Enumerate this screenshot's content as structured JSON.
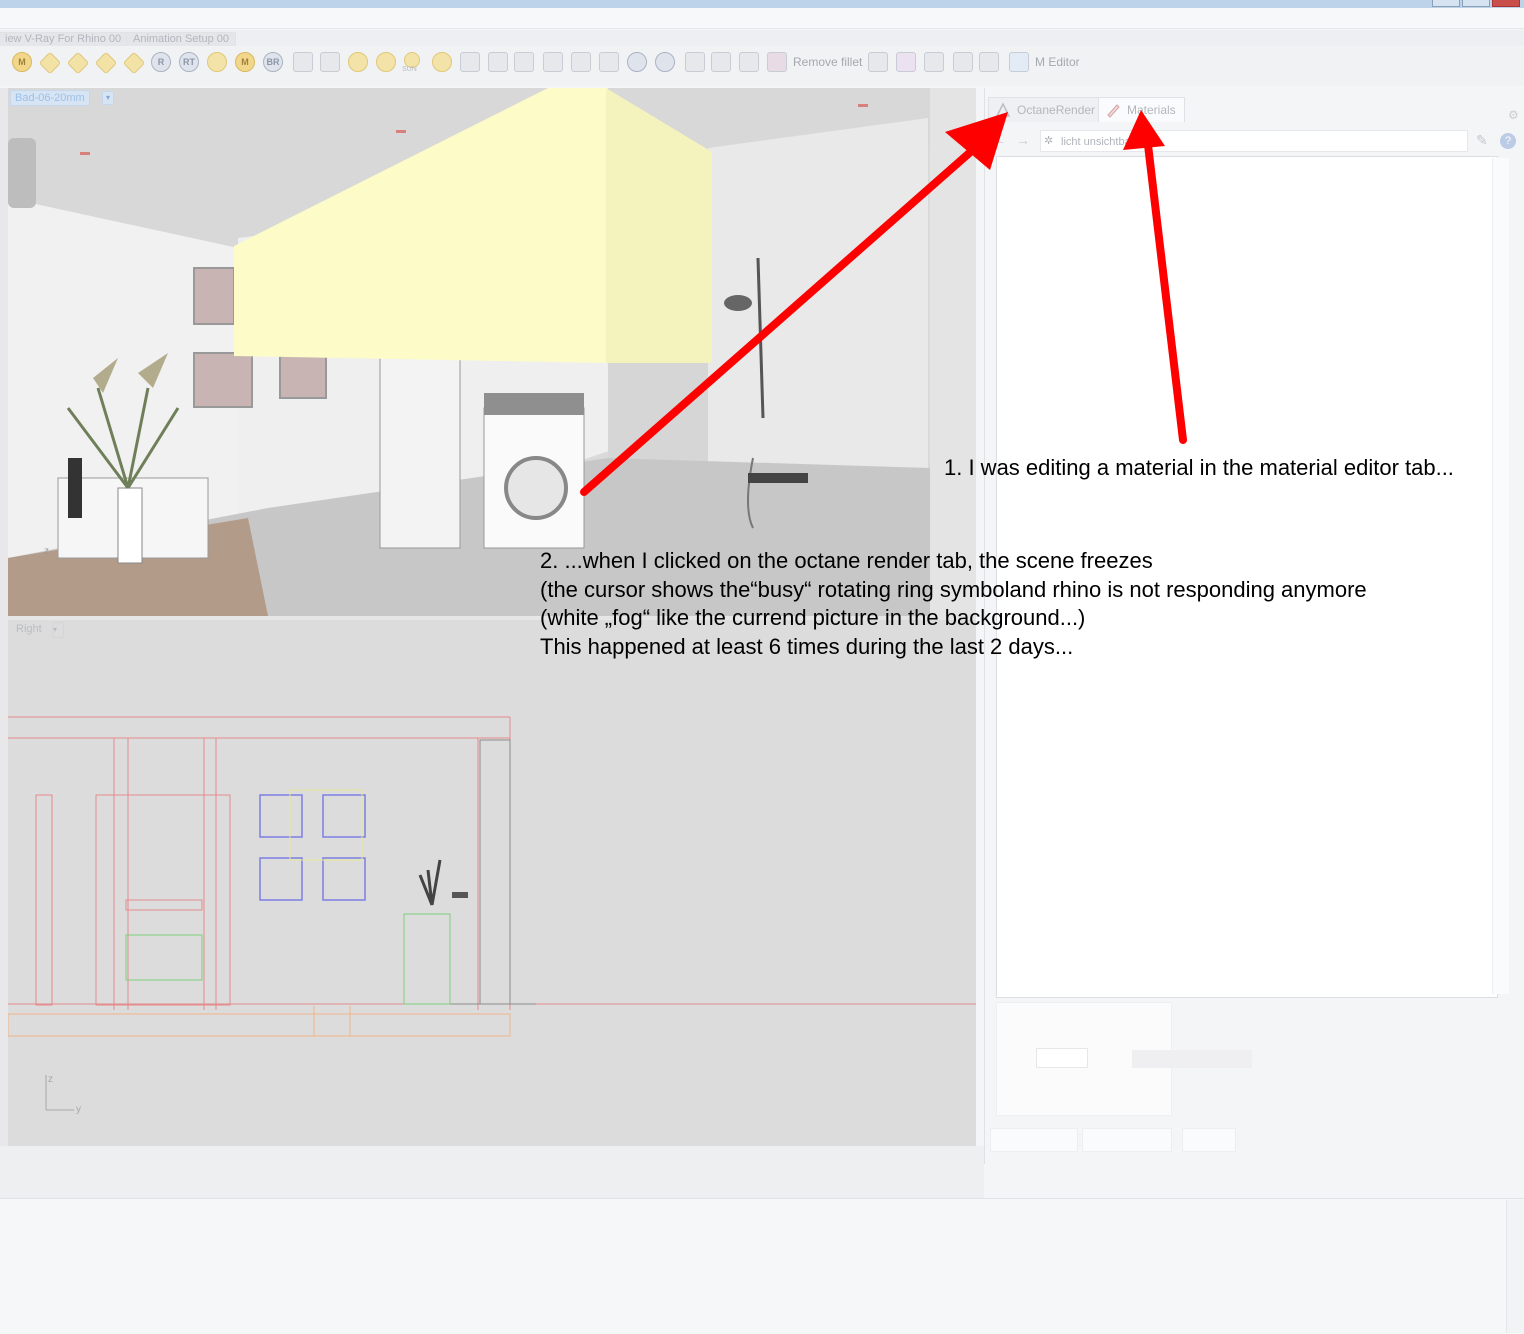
{
  "toolbar_tabs": [
    "iew V-Ray For Rhino 00",
    "Animation Setup 00"
  ],
  "toolbar": {
    "icons": [
      {
        "name": "material-m-icon",
        "glyph": "M"
      },
      {
        "name": "octane-diamond-icon",
        "glyph": ""
      },
      {
        "name": "octane-diamond-icon",
        "glyph": ""
      },
      {
        "name": "octane-diamond-icon",
        "glyph": ""
      },
      {
        "name": "octane-diamond-icon",
        "glyph": ""
      },
      {
        "name": "render-r-icon",
        "glyph": "R"
      },
      {
        "name": "render-rt-icon",
        "glyph": "RT"
      },
      {
        "name": "target-icon",
        "glyph": ""
      },
      {
        "name": "material-m-small-icon",
        "glyph": "M"
      },
      {
        "name": "render-br-icon",
        "glyph": "BR"
      }
    ],
    "sun_label": "SUN",
    "remove_fillet_label": "Remove fillet",
    "m_editor_label": "M Editor"
  },
  "viewports": {
    "top_label": "Bad-06-20mm",
    "bottom_label": "Right",
    "axis_z": "z",
    "axis_y": "y"
  },
  "panel": {
    "tabs": [
      {
        "label": "OctaneRender",
        "icon": "octane-icon"
      },
      {
        "label": "Materials",
        "icon": "materials-brush-icon"
      }
    ],
    "address_text": "licht unsichtba"
  },
  "annotations": {
    "note1": "1. I was editing a material in the material editor tab...",
    "note2_lines": [
      "2. ...when I clicked on the octane render tab, the scene freezes",
      "(the cursor shows the“busy“ rotating ring symboland rhino is not responding anymore",
      "(white „fog“ like the currend picture in the background...)",
      "This happened at least 6 times during the last 2 days..."
    ]
  },
  "colors": {
    "arrow": "#ff0000",
    "viewport_label": "#9cc1e8",
    "yellow_box": "#fdfcc8"
  }
}
